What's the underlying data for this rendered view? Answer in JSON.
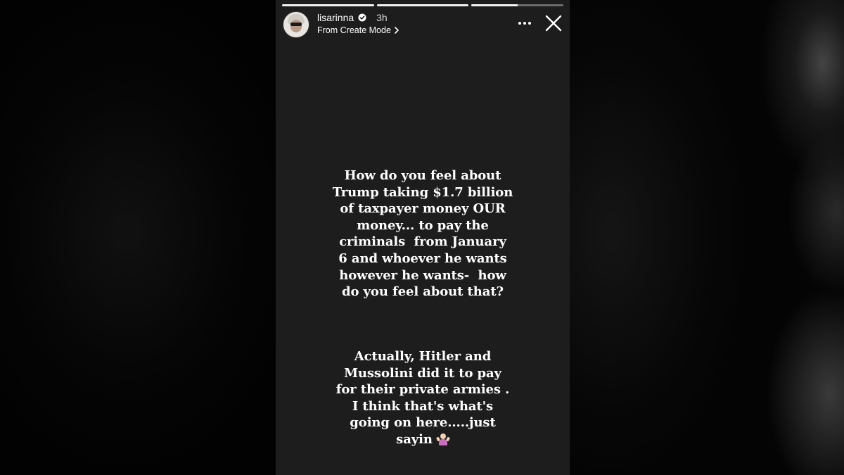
{
  "story": {
    "username": "lisarinna",
    "time": "3h",
    "subtitle": "From Create Mode",
    "progress": [
      1,
      1,
      0.5
    ],
    "text_block_1": [
      "How do you feel about",
      "Trump taking $1.7 billion",
      "of taxpayer money OUR",
      "money... to pay the",
      "criminals  from January",
      "6 and whoever he wants",
      "however he wants-  how",
      "do you feel about that?"
    ],
    "text_block_2": [
      "Actually, Hitler and",
      "Mussolini did it to pay",
      "for their private armies .",
      "I think that's what's",
      "going on here.....just",
      "sayin"
    ],
    "icons": {
      "verified": "verified-badge-icon",
      "more": "more-options-icon",
      "close": "close-icon",
      "chevron": "chevron-right-icon",
      "emoji": "person-shrugging-emoji"
    },
    "colors": {
      "story_background": "#1d1d1d",
      "text": "#ffffff",
      "emoji_shirt": "#c86fc0"
    }
  }
}
